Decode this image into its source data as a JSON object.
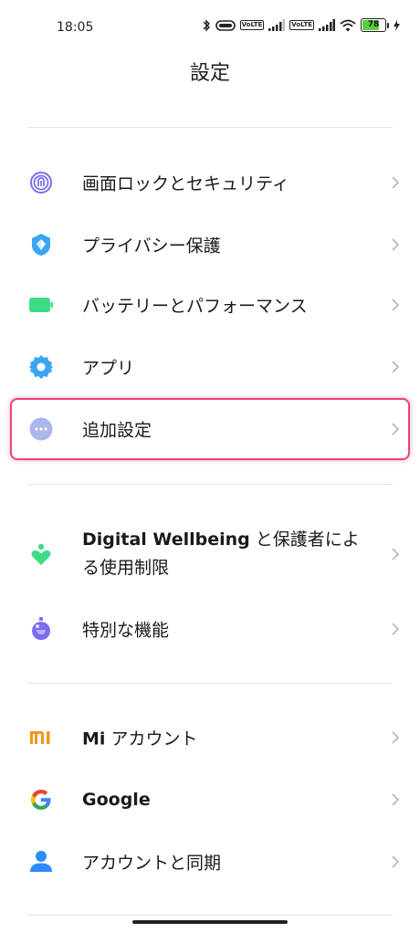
{
  "status_bar": {
    "time": "18:05",
    "volte_label": "VoLTE",
    "battery_level": "78",
    "icons": [
      "bluetooth-icon",
      "alarm-icon",
      "volte-icon",
      "signal-icon",
      "volte-icon",
      "signal-icon",
      "wifi-icon",
      "battery-icon",
      "charging-icon"
    ]
  },
  "header": {
    "title": "設定"
  },
  "items": {
    "screen_lock": {
      "label": "画面ロックとセキュリティ",
      "icon": "fingerprint-icon",
      "color": "#7b6ef0"
    },
    "privacy": {
      "label": "プライバシー保護",
      "icon": "shield-icon",
      "color": "#3aa4f5"
    },
    "battery": {
      "label": "バッテリーとパフォーマンス",
      "icon": "battery-icon",
      "color": "#3ddc84"
    },
    "apps": {
      "label": "アプリ",
      "icon": "gear-icon",
      "color": "#3aa4f5"
    },
    "additional": {
      "label": "追加設定",
      "icon": "more-dots-icon",
      "color": "#a9b7ea"
    },
    "wellbeing": {
      "label_bold": "Digital Wellbeing",
      "label_rest_line1": " と保護者によ",
      "label_line2": "る使用制限",
      "icon": "heart-person-icon",
      "color": "#3ddc84"
    },
    "accessibility": {
      "label": "特別な機能",
      "icon": "accessibility-icon",
      "color": "#7b6ef0"
    },
    "mi_account": {
      "label_bold": "Mi",
      "label_rest": " アカウント",
      "icon": "mi-logo-icon",
      "color": "#f7941d"
    },
    "google": {
      "label": "Google",
      "icon": "google-logo-icon"
    },
    "accounts_sync": {
      "label": "アカウントと同期",
      "icon": "person-icon",
      "color": "#2e8bff"
    }
  },
  "highlight_color": "#e8457a"
}
